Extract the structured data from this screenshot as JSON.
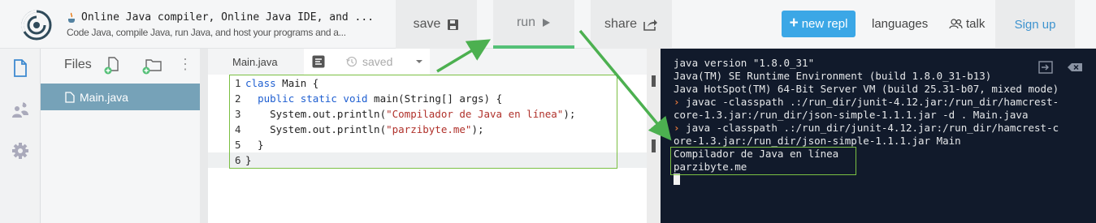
{
  "header": {
    "title": "Online Java compiler, Online Java IDE, and ...",
    "subtitle": "Code Java, compile Java, run Java, and host your programs and a...",
    "save_label": "save",
    "run_label": "run",
    "share_label": "share",
    "new_repl_label": "new repl",
    "languages_label": "languages",
    "talk_label": "talk",
    "signup_label": "Sign up"
  },
  "files": {
    "title": "Files",
    "items": [
      "Main.java"
    ]
  },
  "editor": {
    "tab_label": "Main.java",
    "status": "saved",
    "lines": [
      {
        "n": "1",
        "segments": [
          {
            "t": "class",
            "c": "kw"
          },
          {
            "t": " Main {",
            "c": "code"
          }
        ]
      },
      {
        "n": "2",
        "segments": [
          {
            "t": "  ",
            "c": "code"
          },
          {
            "t": "public static void",
            "c": "kw"
          },
          {
            "t": " main(String[] args) {",
            "c": "code"
          }
        ]
      },
      {
        "n": "3",
        "segments": [
          {
            "t": "    System.out.println(",
            "c": "code"
          },
          {
            "t": "\"Compilador de Java en línea\"",
            "c": "str"
          },
          {
            "t": ");",
            "c": "code"
          }
        ]
      },
      {
        "n": "4",
        "segments": [
          {
            "t": "    System.out.println(",
            "c": "code"
          },
          {
            "t": "\"parzibyte.me\"",
            "c": "str"
          },
          {
            "t": ");",
            "c": "code"
          }
        ]
      },
      {
        "n": "5",
        "segments": [
          {
            "t": "  }",
            "c": "code"
          }
        ]
      },
      {
        "n": "6",
        "segments": [
          {
            "t": "}",
            "c": "code"
          }
        ]
      }
    ]
  },
  "console": {
    "lines": [
      {
        "prompt": "",
        "text": "java version \"1.8.0_31\""
      },
      {
        "prompt": "",
        "text": "Java(TM) SE Runtime Environment (build 1.8.0_31-b13)"
      },
      {
        "prompt": "",
        "text": "Java HotSpot(TM) 64-Bit Server VM (build 25.31-b07, mixed mode)"
      },
      {
        "prompt": "›",
        "text": " javac -classpath .:/run_dir/junit-4.12.jar:/run_dir/hamcrest-"
      },
      {
        "prompt": "",
        "text": "core-1.3.jar:/run_dir/json-simple-1.1.1.jar -d . Main.java"
      },
      {
        "prompt": "›",
        "text": " java -classpath .:/run_dir/junit-4.12.jar:/run_dir/hamcrest-c"
      },
      {
        "prompt": "",
        "text": "ore-1.3.jar:/run_dir/json-simple-1.1.1.jar Main"
      },
      {
        "prompt": "",
        "text": "Compilador de Java en línea"
      },
      {
        "prompt": "",
        "text": "parzibyte.me"
      }
    ]
  },
  "colors": {
    "accent_blue": "#3ba7e6",
    "run_underline": "#54c077",
    "annotation_green": "#4cb050",
    "console_bg": "#111a2b",
    "prompt_orange": "#e3763b"
  },
  "icons": [
    "repl-logo",
    "java-icon",
    "floppy-icon",
    "play-icon",
    "share-icon",
    "plus-icon",
    "users-icon",
    "file-icon",
    "collaborators-icon",
    "gear-icon",
    "add-file-icon",
    "add-folder-icon",
    "more-icon",
    "format-icon",
    "history-icon",
    "chevron-down-icon",
    "exit-icon",
    "clear-icon"
  ]
}
